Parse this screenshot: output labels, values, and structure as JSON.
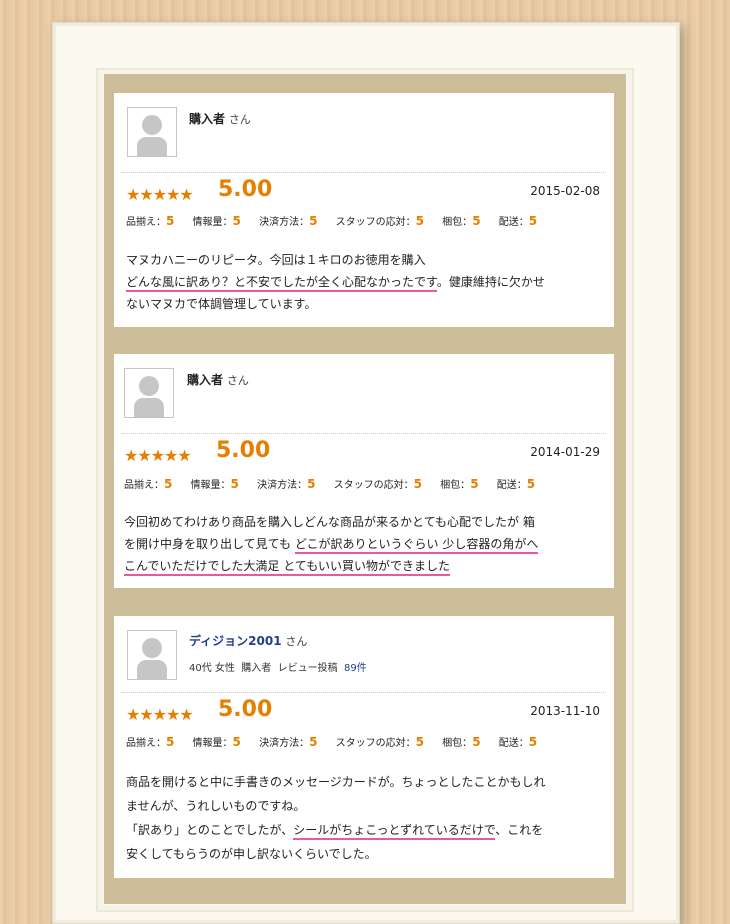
{
  "reviews": [
    {
      "reviewer": "購入者",
      "honorific": "さん",
      "rating_stars": "★★★★★",
      "rating": "5.00",
      "date": "2015-02-08",
      "sub_ratings": [
        {
          "label": "品揃え：",
          "value": "5"
        },
        {
          "label": "情報量：",
          "value": "5"
        },
        {
          "label": "決済方法：",
          "value": "5"
        },
        {
          "label": "スタッフの応対：",
          "value": "5"
        },
        {
          "label": "梱包：",
          "value": "5"
        },
        {
          "label": "配送：",
          "value": "5"
        }
      ],
      "body": {
        "l1": "マヌカハニーのリピータ。今回は１キロのお徳用を購入",
        "l2_hl": "どんな風に訳あり？と不安でしたが全く心配なかったです",
        "l2_rest": "。健康維持に欠かせ",
        "l3": "ないマヌカで体調管理しています。"
      }
    },
    {
      "reviewer": "購入者",
      "honorific": "さん",
      "rating_stars": "★★★★★",
      "rating": "5.00",
      "date": "2014-01-29",
      "sub_ratings": [
        {
          "label": "品揃え：",
          "value": "5"
        },
        {
          "label": "情報量：",
          "value": "5"
        },
        {
          "label": "決済方法：",
          "value": "5"
        },
        {
          "label": "スタッフの応対：",
          "value": "5"
        },
        {
          "label": "梱包：",
          "value": "5"
        },
        {
          "label": "配送：",
          "value": "5"
        }
      ],
      "body": {
        "l1": "今回初めてわけあり商品を購入しどんな商品が来るかとても心配でしたが 箱",
        "l2_pre": "を開け中身を取り出して見ても ",
        "l2_hl": "どこが訳ありというぐらい 少し容器の角がへ",
        "l3_hl": "こんでいただけでした大満足 とてもいい買い物ができました"
      }
    },
    {
      "reviewer": "ディジョン2001",
      "honorific": "さん",
      "meta": {
        "age_gender": "40代 女性",
        "buyer": "購入者",
        "posts_label": "レビュー投稿",
        "posts_count": "89件"
      },
      "rating_stars": "★★★★★",
      "rating": "5.00",
      "date": "2013-11-10",
      "sub_ratings": [
        {
          "label": "品揃え：",
          "value": "5"
        },
        {
          "label": "情報量：",
          "value": "5"
        },
        {
          "label": "決済方法：",
          "value": "5"
        },
        {
          "label": "スタッフの応対：",
          "value": "5"
        },
        {
          "label": "梱包：",
          "value": "5"
        },
        {
          "label": "配送：",
          "value": "5"
        }
      ],
      "body": {
        "l1": "商品を開けると中に手書きのメッセージカードが。ちょっとしたことかもしれ",
        "l2": "ませんが、うれしいものですね。",
        "l3_pre": "「訳あり」とのことでしたが、",
        "l3_hl": "シールがちょこっとずれているだけで",
        "l3_post": "、これを",
        "l4": "安くしてもらうのが申し訳ないくらいでした。"
      }
    }
  ],
  "colors": {
    "accent": "#e67e00",
    "highlight": "#e45aa8",
    "link": "#233f8a",
    "mat": "#cbbe99"
  }
}
